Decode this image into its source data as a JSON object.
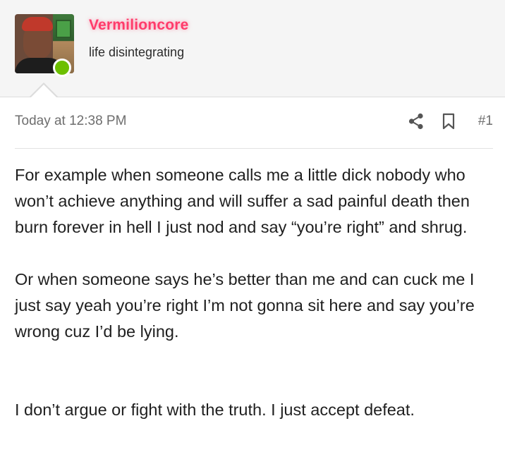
{
  "user": {
    "name": "Vermilioncore",
    "title": "life disintegrating",
    "online_color": "#6cbf00",
    "name_color": "#ff3b6b"
  },
  "post": {
    "timestamp": "Today at 12:38 PM",
    "number": "#1",
    "icons": [
      "share-icon",
      "bookmark-icon"
    ],
    "paragraphs": [
      "For example when someone calls me a little dick nobody who won’t achieve anything and will suffer a sad painful death then burn forever in hell I just nod and say “you’re right” and shrug.",
      "Or when someone says he’s better than me and can cuck me I just say yeah you’re right I’m not gonna sit here and say you’re wrong cuz I’d be lying.",
      "I don’t argue or fight with the truth. I just accept defeat."
    ]
  }
}
